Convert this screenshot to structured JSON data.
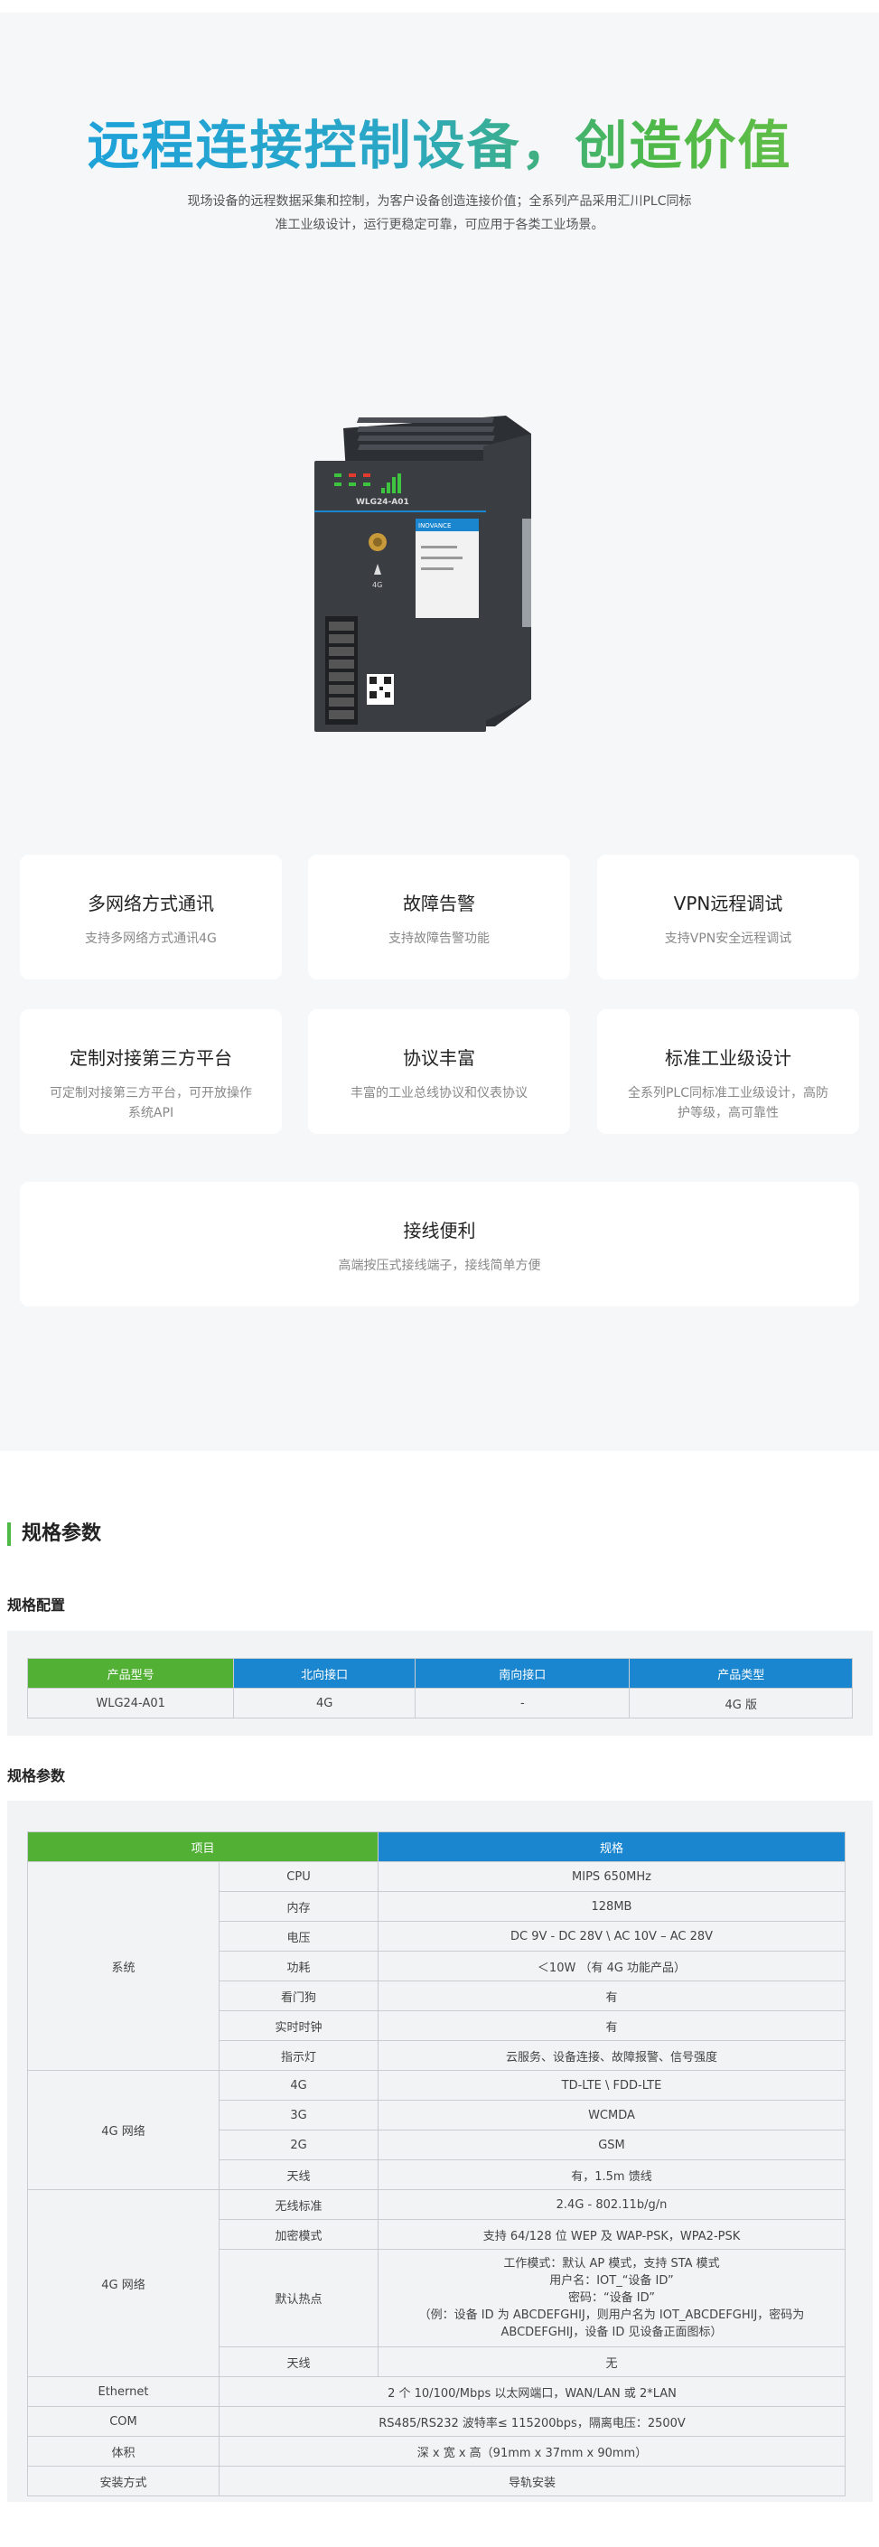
{
  "hero": {
    "title": "远程连接控制设备，创造价值",
    "subtitle_line1": "现场设备的远程数据采集和控制，为客户设备创造连接价值；全系列产品采用汇川PLC同标",
    "subtitle_line2": "准工业级设计，运行更稳定可靠，可应用于各类工业场景。"
  },
  "device": {
    "model": "WLG24-A01",
    "brand": "INOVANCE",
    "antenna_label": "4G",
    "colors": {
      "body": "#3a3d42",
      "accent": "#1a86cf",
      "led_green": "#3ec43e",
      "led_red": "#e23a2e"
    }
  },
  "features": [
    {
      "title": "多网络方式通讯",
      "desc": "支持多网络方式通讯4G"
    },
    {
      "title": "故障告警",
      "desc": "支持故障告警功能"
    },
    {
      "title": "VPN远程调试",
      "desc": "支持VPN安全远程调试"
    },
    {
      "title": "定制对接第三方平台",
      "desc": "可定制对接第三方平台，可开放操作系统API"
    },
    {
      "title": "协议丰富",
      "desc": "丰富的工业总线协议和仪表协议"
    },
    {
      "title": "标准工业级设计",
      "desc": "全系列PLC同标准工业级设计，高防护等级，高可靠性"
    },
    {
      "title": "接线便利",
      "desc": "高端按压式接线端子，接线简单方便"
    }
  ],
  "spec": {
    "section_title": "规格参数",
    "config_title": "规格配置",
    "config_headers": [
      "产品型号",
      "北向接口",
      "南向接口",
      "产品类型"
    ],
    "config_row": [
      "WLG24-A01",
      "4G",
      "-",
      "4G 版"
    ],
    "param_title": "规格参数",
    "param_headers": [
      "项目",
      "规格"
    ],
    "groups": {
      "system": "系统",
      "net4g": "4G 网络",
      "wifi": "4G 网络"
    },
    "rows": {
      "cpu": [
        "CPU",
        "MIPS 650MHz"
      ],
      "mem": [
        "内存",
        "128MB"
      ],
      "volt": [
        "电压",
        "DC 9V - DC 28V \\ AC 10V – AC 28V"
      ],
      "power": [
        "功耗",
        "＜10W （有 4G 功能产品）"
      ],
      "wd": [
        "看门狗",
        "有"
      ],
      "rtc": [
        "实时时钟",
        "有"
      ],
      "led": [
        "指示灯",
        "云服务、设备连接、故障报警、信号强度"
      ],
      "g4": [
        "4G",
        "TD-LTE \\ FDD-LTE"
      ],
      "g3": [
        "3G",
        "WCMDA"
      ],
      "g2": [
        "2G",
        "GSM"
      ],
      "ant": [
        "天线",
        "有，1.5m 馈线"
      ],
      "wstd": [
        "无线标准",
        "2.4G - 802.11b/g/n"
      ],
      "enc": [
        "加密模式",
        "支持 64/128 位 WEP 及 WAP-PSK，WPA2-PSK"
      ],
      "hot_label": "默认热点",
      "hot_lines": [
        "工作模式：默认 AP 模式，支持 STA 模式",
        "用户名：IOT_“设备 ID”",
        "密码：“设备 ID”",
        "（例：设备 ID 为 ABCDEFGHIJ，则用户名为 IOT_ABCDEFGHIJ，密码为",
        "ABCDEFGHIJ，设备 ID 见设备正面图标）"
      ],
      "want": [
        "天线",
        "无"
      ],
      "eth": [
        "Ethernet",
        "2 个 10/100/Mbps 以太网端口，WAN/LAN 或 2*LAN"
      ],
      "com": [
        "COM",
        "RS485/RS232 波特率≤ 115200bps，隔离电压：2500V"
      ],
      "size": [
        "体积",
        "深 x 宽 x 高（91mm x 37mm x 90mm）"
      ],
      "mount": [
        "安装方式",
        "导轨安装"
      ]
    }
  }
}
